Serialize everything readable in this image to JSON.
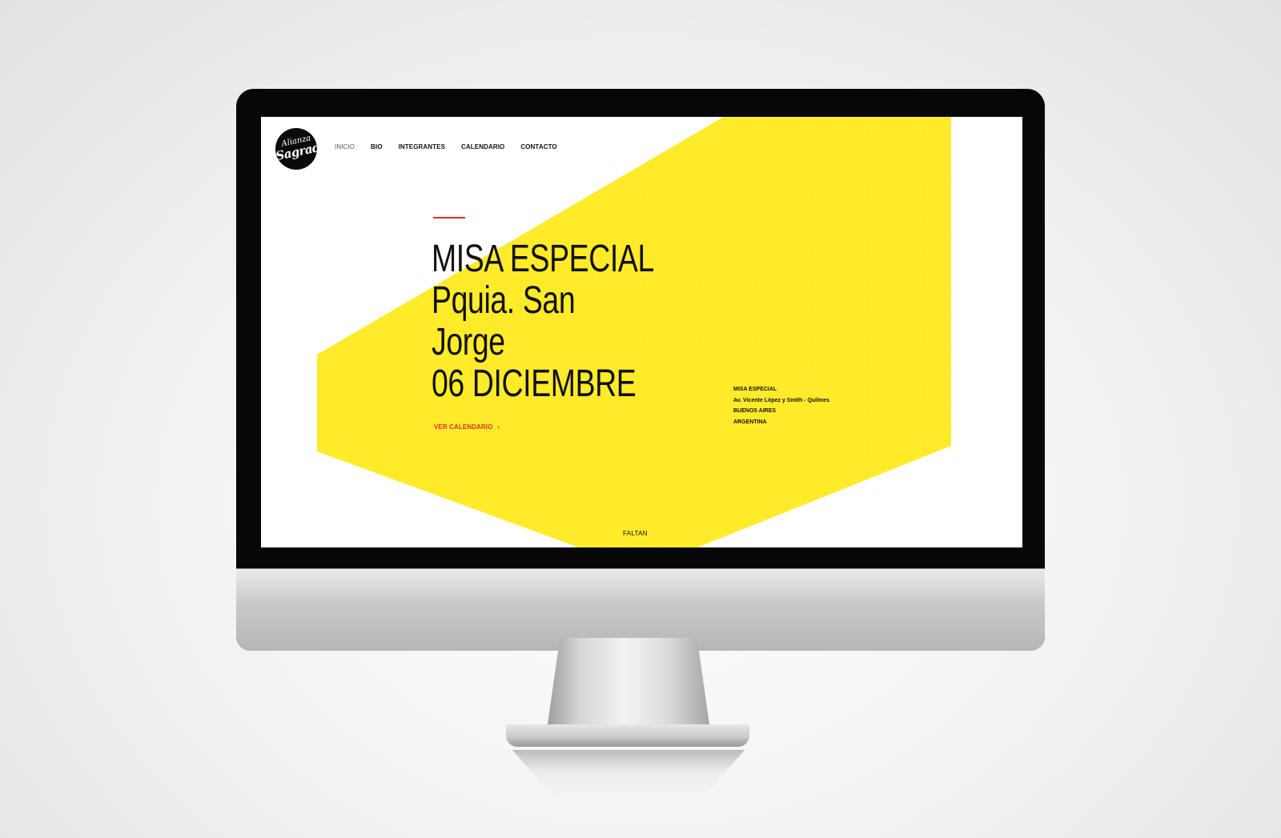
{
  "logo": {
    "line1": "Alianza",
    "line2": "Sagrada"
  },
  "nav": {
    "items": [
      {
        "label": "INICIO"
      },
      {
        "label": "BIO"
      },
      {
        "label": "INTEGRANTES"
      },
      {
        "label": "CALENDARIO"
      },
      {
        "label": "CONTACTO"
      }
    ]
  },
  "hero": {
    "lines": [
      "MISA ESPECIAL",
      "Pquia. San",
      "Jorge",
      "06 DICIEMBRE"
    ],
    "cta_label": "VER CALENDARIO",
    "cta_icon": "chevron-right-icon"
  },
  "info": {
    "lines": [
      "MISA ESPECIAL",
      "Av. Vicente López y Smith - Quilmes",
      "BUENOS AIRES",
      "ARGENTINA"
    ]
  },
  "countdown": {
    "label": "FALTAN"
  },
  "colors": {
    "accent_yellow": "#ffeb2a",
    "accent_red": "#e62b2b",
    "text": "#111111",
    "monitor_bezel": "#070707"
  }
}
